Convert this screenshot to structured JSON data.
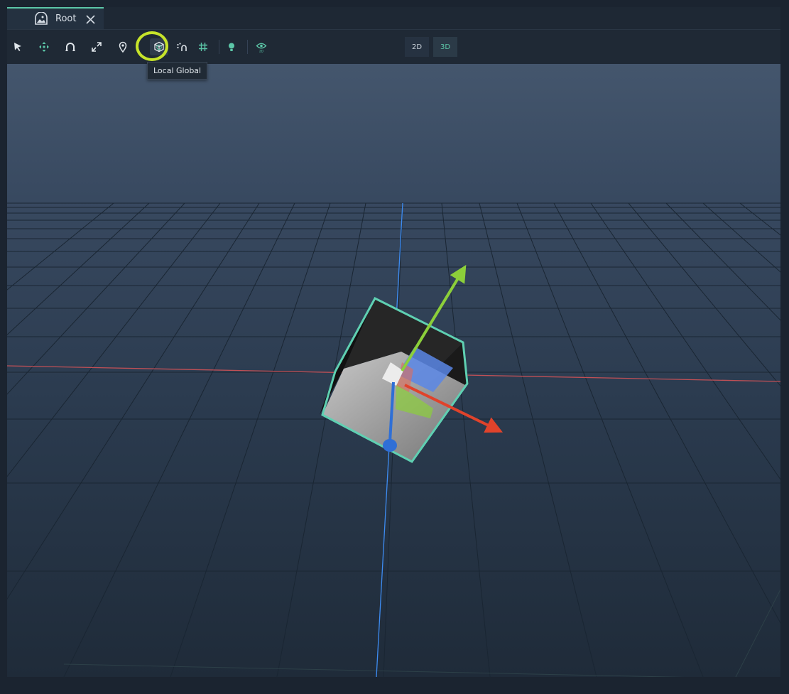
{
  "tab": {
    "label": "Root",
    "icon": "scene-icon"
  },
  "toolbar": {
    "tools": [
      {
        "name": "select-tool",
        "icon": "cursor-icon"
      },
      {
        "name": "move-tool",
        "icon": "move-arrows-icon"
      },
      {
        "name": "rotate-tool",
        "icon": "rotate-icon"
      },
      {
        "name": "scale-tool",
        "icon": "expand-icon"
      },
      {
        "name": "pivot-tool",
        "icon": "location-pin-icon"
      },
      {
        "name": "local-global-toggle",
        "icon": "local-global-cube-icon",
        "active": true
      },
      {
        "name": "snap-tool",
        "icon": "snap-icon"
      },
      {
        "name": "grid-toggle",
        "icon": "grid-icon"
      },
      {
        "name": "light-toggle",
        "icon": "light-bulb-icon"
      },
      {
        "name": "view-2d-toggle",
        "icon": "eye-icon",
        "caption": "2D"
      }
    ],
    "mode_2d_label": "2D",
    "mode_3d_label": "3D",
    "active_mode": "3D"
  },
  "tooltip": {
    "text": "Local Global"
  },
  "colors": {
    "accent": "#5cc7a8",
    "highlight": "#c6e32a",
    "axis_x": "#e0432b",
    "axis_y": "#8ccf3a",
    "axis_z": "#2f6fd6"
  }
}
